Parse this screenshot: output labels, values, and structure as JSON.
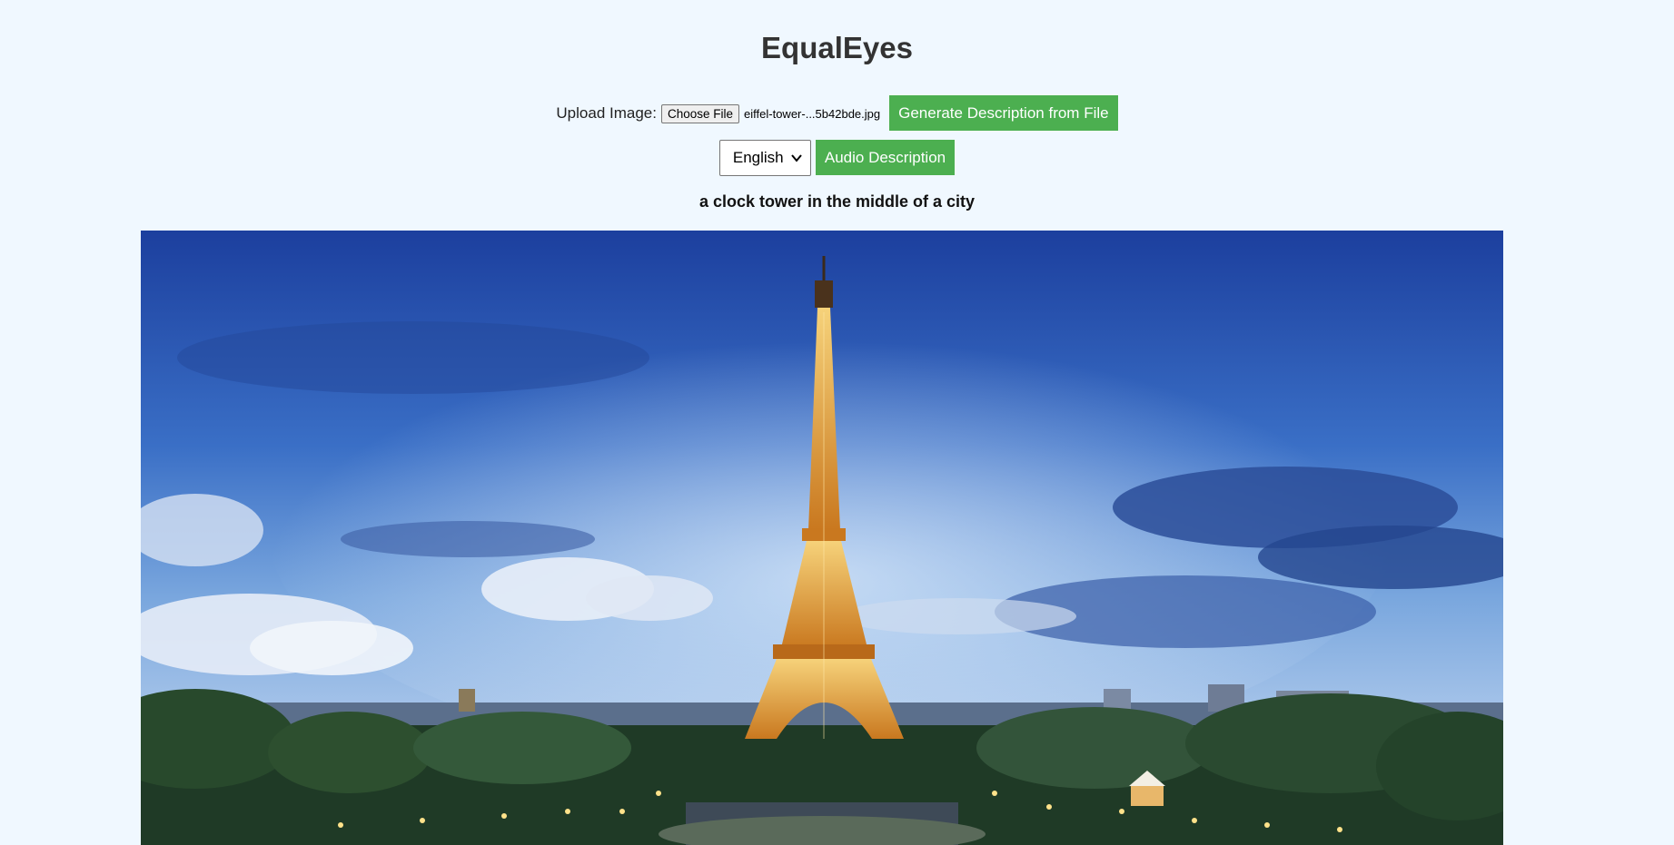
{
  "app": {
    "title": "EqualEyes"
  },
  "upload": {
    "label": "Upload Image:",
    "choose_file_label": "Choose File",
    "file_name": "eiffel-tower-...5b42bde.jpg",
    "generate_button_label": "Generate Description from File"
  },
  "language": {
    "selected": "English",
    "audio_button_label": "Audio Description"
  },
  "result": {
    "caption": "a clock tower in the middle of a city"
  },
  "colors": {
    "background": "#f0f8ff",
    "button_green": "#4caf50",
    "title": "#333333"
  }
}
